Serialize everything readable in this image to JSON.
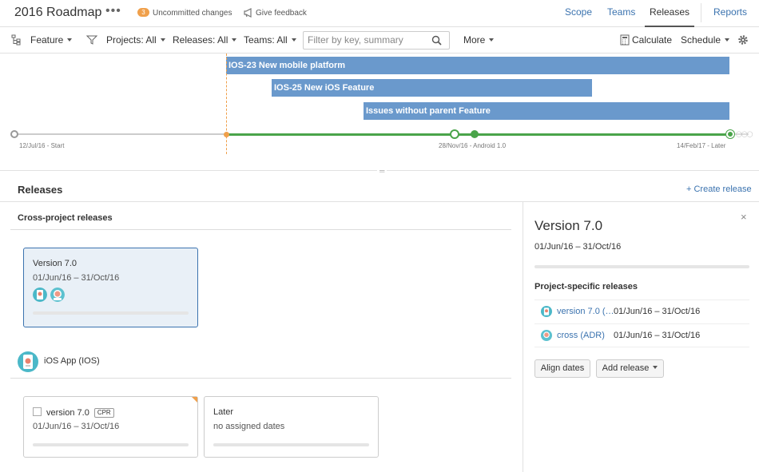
{
  "header": {
    "title": "2016 Roadmap",
    "more_dots": "•••",
    "changes_count": "3",
    "uncommitted_label": "Uncommitted changes",
    "feedback_label": "Give feedback",
    "nav": [
      "Scope",
      "Teams",
      "Releases",
      "Reports"
    ],
    "active_nav": "Releases"
  },
  "toolbar": {
    "group_by": "Feature",
    "projects": "Projects: All",
    "releases": "Releases: All",
    "teams": "Teams: All",
    "search_placeholder": "Filter by key, summary",
    "more": "More",
    "calculate": "Calculate",
    "schedule": "Schedule"
  },
  "timeline": {
    "bars": [
      {
        "label": "IOS-23 New mobile platform"
      },
      {
        "label": "IOS-25 New iOS Feature"
      },
      {
        "label": "Issues without parent Feature"
      }
    ],
    "markers": {
      "start": "12/Jul/16 - Start",
      "mid": "28/Nov/16 - Android 1.0",
      "end": "14/Feb/17 - Later"
    }
  },
  "releases": {
    "title": "Releases",
    "create_label": "+ Create release",
    "cross_title": "Cross-project releases",
    "cross_cards": [
      {
        "name": "Version 7.0",
        "dates": "01/Jun/16 – 31/Oct/16"
      }
    ],
    "project": {
      "name": "iOS App (IOS)",
      "cards": [
        {
          "name": "version 7.0",
          "tag": "CPR",
          "dates": "01/Jun/16 – 31/Oct/16"
        },
        {
          "name": "Later",
          "dates": "no assigned dates"
        }
      ]
    }
  },
  "detail": {
    "close": "×",
    "title": "Version 7.0",
    "dates": "01/Jun/16 – 31/Oct/16",
    "psr_title": "Project-specific releases",
    "rows": [
      {
        "link": "version 7.0 (…",
        "dates": "01/Jun/16 – 31/Oct/16"
      },
      {
        "link": "cross (ADR)",
        "dates": "01/Jun/16 – 31/Oct/16"
      }
    ],
    "align_button": "Align dates",
    "add_button": "Add release"
  },
  "colors": {
    "accent": "#3b73af",
    "bar": "#6a99cc",
    "track": "#4aa44a",
    "today": "#f0a04b"
  }
}
